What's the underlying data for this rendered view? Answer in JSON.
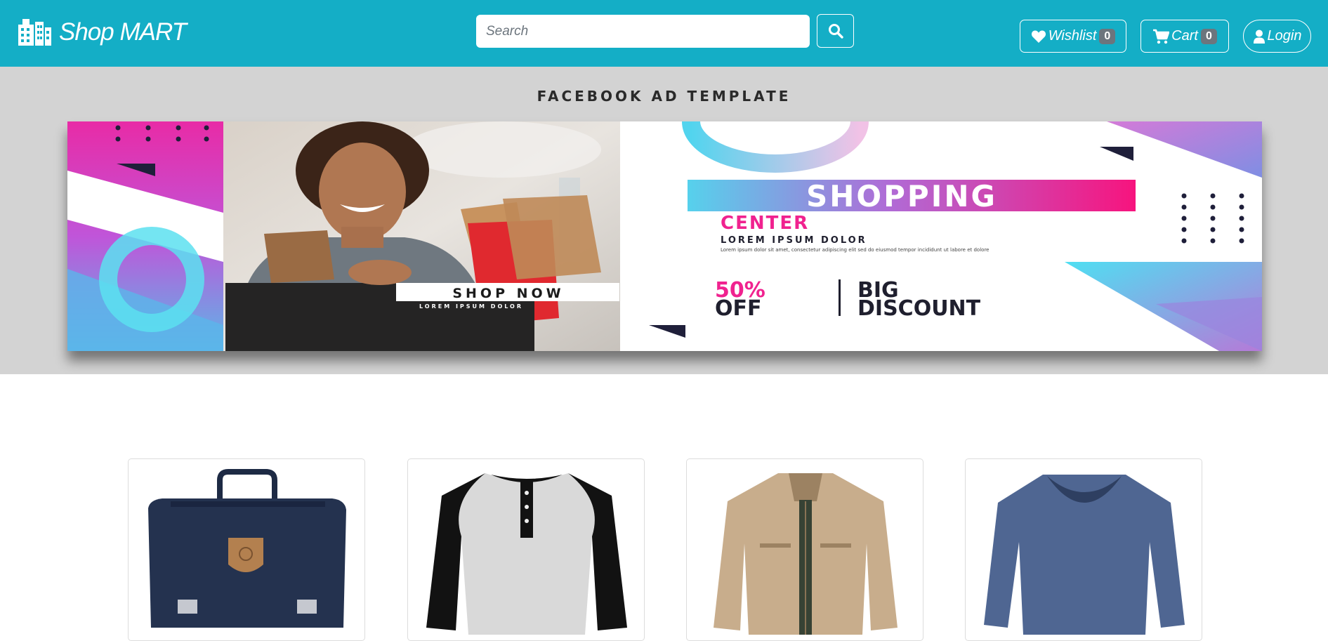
{
  "navbar": {
    "brand": "Shop MART",
    "brand_icon": "building-icon",
    "search_placeholder": "Search",
    "search_icon": "search-icon",
    "wishlist": {
      "label": "Wishlist",
      "count": "0",
      "icon": "heart-icon"
    },
    "cart": {
      "label": "Cart",
      "count": "0",
      "icon": "cart-icon"
    },
    "login": {
      "label": "Login",
      "icon": "user-icon"
    }
  },
  "hero": {
    "caption": "FACEBOOK AD TEMPLATE",
    "banner": {
      "headline": "SHOPPING",
      "subheadline": "CENTER",
      "tagline": "LOREM IPSUM DOLOR",
      "body_text": "Lorem ipsum dolor sit amet, consectetur adipiscing elit sed do eiusmod tempor incididunt ut labore et dolore",
      "cta": "SHOP NOW",
      "cta_sub": "LOREM IPSUM DOLOR",
      "offer_percent": "50%",
      "offer_off": "OFF",
      "offer_big": "BIG",
      "offer_discount": "DISCOUNT"
    }
  },
  "products": [
    {
      "name": "backpack"
    },
    {
      "name": "raglan henley shirt"
    },
    {
      "name": "khaki jacket"
    },
    {
      "name": "blue v-neck sweater"
    }
  ],
  "colors": {
    "navbar": "#14aec6",
    "hero_bg": "#d3d3d3",
    "accent_pink": "#f0228f",
    "accent_cyan": "#4cd7ee",
    "badge": "#6c757d"
  }
}
